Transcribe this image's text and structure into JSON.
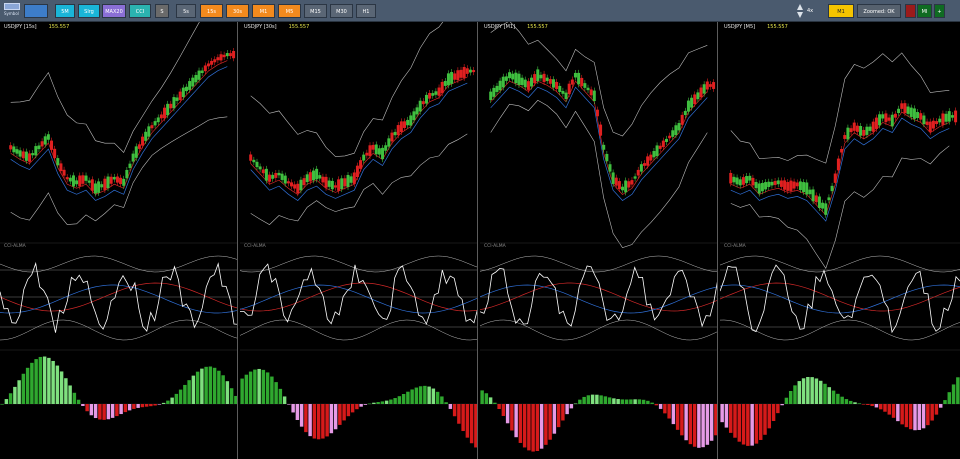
{
  "toolbar": {
    "logo_text": "Symbol",
    "buttons": [
      {
        "label": "",
        "name": "symbol-select-button",
        "color": "#3d7dc9"
      },
      {
        "label": "5M",
        "name": "tf-5m-button",
        "color": "#1ab5d8"
      },
      {
        "label": "Slrg",
        "name": "strategy-button",
        "color": "#1ab5d8"
      },
      {
        "label": "MAX20",
        "name": "max20-button",
        "color": "#8a6fd6"
      },
      {
        "label": "CCI",
        "name": "cci-button",
        "color": "#2bb3b0"
      },
      {
        "label": "S",
        "name": "s-button",
        "color": "#6a6a6a"
      },
      {
        "label": "5s",
        "name": "tf-5s-button",
        "color": "#5a6675"
      },
      {
        "label": "15s",
        "name": "tf-15s-button",
        "color": "#f28a1e"
      },
      {
        "label": "30s",
        "name": "tf-30s-button",
        "color": "#f28a1e"
      },
      {
        "label": "M1",
        "name": "tf-m1-button",
        "color": "#f28a1e"
      },
      {
        "label": "M5",
        "name": "tf-m5-button",
        "color": "#f28a1e"
      },
      {
        "label": "M15",
        "name": "tf-m15-button",
        "color": "#5a6675"
      },
      {
        "label": "M30",
        "name": "tf-m30-button",
        "color": "#5a6675"
      },
      {
        "label": "H1",
        "name": "tf-h1-button",
        "color": "#5a6675"
      }
    ],
    "spinner_value": "4x",
    "m1_badge": "M1",
    "zoom_label": "Zoomed: OK",
    "toggle_label": "MI",
    "plus_label": "+"
  },
  "panes": [
    {
      "symbol": "USDJPY [15s]",
      "price": "155.557",
      "indicator": "CCI-ALMA"
    },
    {
      "symbol": "USDJPY [30s]",
      "price": "155.557",
      "indicator": "CCI-ALMA"
    },
    {
      "symbol": "USDJPY [M1]",
      "price": "155.557",
      "indicator": "CCI-ALMA"
    },
    {
      "symbol": "USDJPY [M5]",
      "price": "155.557",
      "indicator": "CCI-ALMA"
    }
  ],
  "colors": {
    "bull": "#3fbf3f",
    "bear": "#e02020",
    "hist_bull_strong": "#2fa82f",
    "hist_bull_weak": "#7fe07f",
    "hist_bear_strong": "#d61a1a",
    "hist_bear_weak": "#e69ae6",
    "band": "#bdbdbd",
    "ma_red": "#d02828",
    "ma_blue": "#2f6fd6",
    "cci": "#ffffff"
  }
}
